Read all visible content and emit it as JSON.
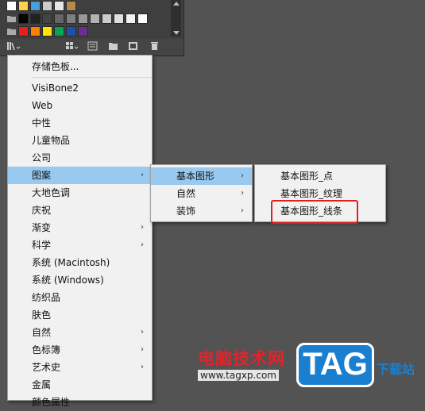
{
  "colors": {
    "background": "#535353",
    "menu_bg": "#f1f1f1",
    "highlight": "#99c9ef",
    "annotation": "#e02020"
  },
  "swatch_panel": {
    "row1": [
      "#ffffff",
      "#ffd24a",
      "#46a0e0",
      "#cccccc",
      "#e6e6e6",
      "#b88a4a"
    ],
    "row2": [
      "#000000",
      "#222222",
      "#444444",
      "#666666",
      "#808080",
      "#999999",
      "#b3b3b3",
      "#cccccc",
      "#e0e0e0",
      "#f2f2f2",
      "#ffffff"
    ],
    "row3": [
      "#e61e1e",
      "#ff7f00",
      "#ffe600",
      "#00a650",
      "#1f4fa6",
      "#6f2c91"
    ],
    "toolbar_icons": [
      "library-icon",
      "swatch-options-icon",
      "list-view-icon",
      "new-folder-icon",
      "new-swatch-icon",
      "delete-icon"
    ]
  },
  "main_menu": {
    "items": [
      {
        "label": "存储色板...",
        "has_sub": false
      },
      {
        "separator": true
      },
      {
        "label": "VisiBone2",
        "has_sub": false
      },
      {
        "label": "Web",
        "has_sub": false
      },
      {
        "label": "中性",
        "has_sub": false
      },
      {
        "label": "儿童物品",
        "has_sub": false
      },
      {
        "label": "公司",
        "has_sub": false
      },
      {
        "label": "图案",
        "has_sub": true,
        "highlighted": true
      },
      {
        "label": "大地色调",
        "has_sub": false
      },
      {
        "label": "庆祝",
        "has_sub": false
      },
      {
        "label": "渐变",
        "has_sub": true
      },
      {
        "label": "科学",
        "has_sub": true
      },
      {
        "label": "系统 (Macintosh)",
        "has_sub": false
      },
      {
        "label": "系统 (Windows)",
        "has_sub": false
      },
      {
        "label": "纺织品",
        "has_sub": false
      },
      {
        "label": "肤色",
        "has_sub": false
      },
      {
        "label": "自然",
        "has_sub": true
      },
      {
        "label": "色标簿",
        "has_sub": true
      },
      {
        "label": "艺术史",
        "has_sub": true
      },
      {
        "label": "金属",
        "has_sub": false
      },
      {
        "label": "颜色属性",
        "has_sub": false
      }
    ]
  },
  "sub_menu": {
    "items": [
      {
        "label": "基本图形",
        "has_sub": true,
        "highlighted": true
      },
      {
        "label": "自然",
        "has_sub": true
      },
      {
        "label": "装饰",
        "has_sub": true
      }
    ]
  },
  "sub_sub_menu": {
    "items": [
      {
        "label": "基本图形_点"
      },
      {
        "label": "基本图形_纹理"
      },
      {
        "label": "基本图形_线条"
      }
    ]
  },
  "watermark": {
    "cn": "电脑技术网",
    "url": "www.tagxp.com",
    "logo": "TAG",
    "side": "下载站"
  }
}
